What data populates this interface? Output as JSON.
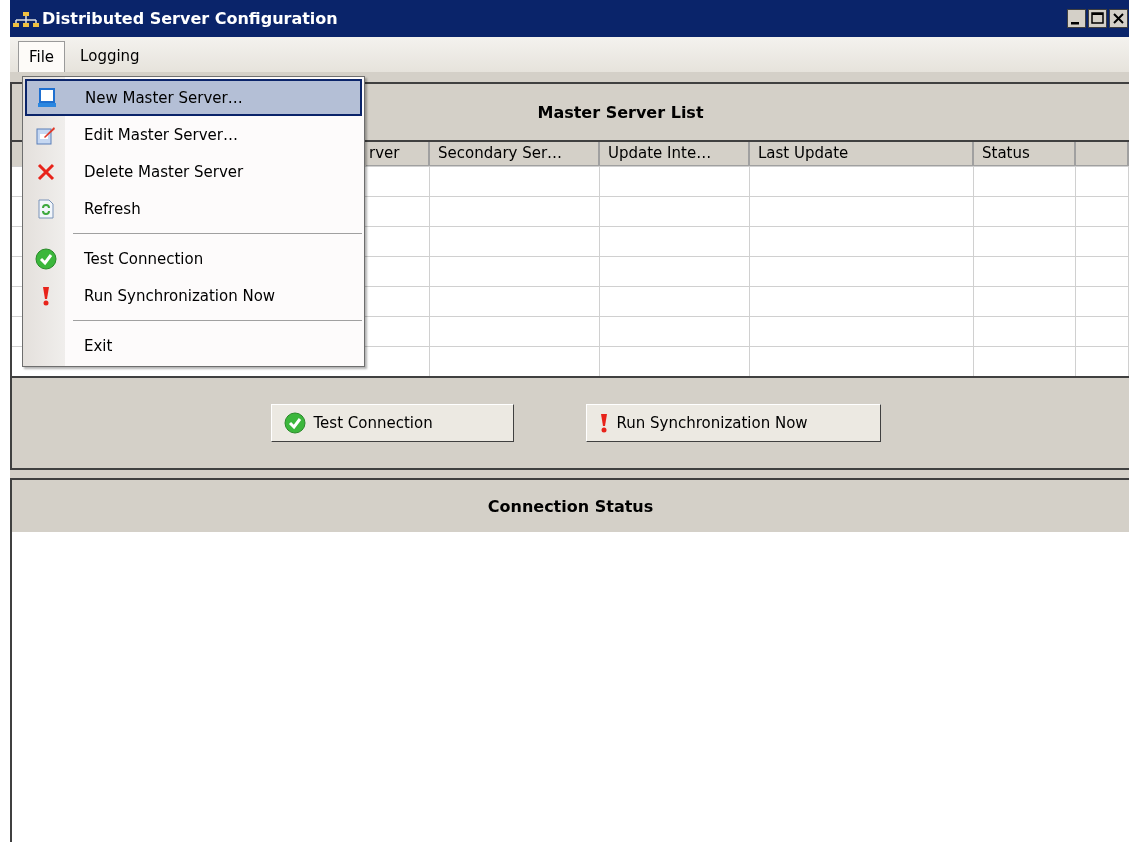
{
  "window": {
    "title": "Distributed Server Configuration"
  },
  "menu_bar": [
    {
      "label": "File",
      "selected": true
    },
    {
      "label": "Logging",
      "selected": false
    }
  ],
  "file_menu": [
    {
      "kind": "item",
      "label": "New Master Server…",
      "selected": true
    },
    {
      "kind": "item",
      "label": "Edit Master Server…",
      "selected": false
    },
    {
      "kind": "item",
      "label": "Delete Master Server",
      "selected": false
    },
    {
      "kind": "item",
      "label": "Refresh",
      "selected": false
    },
    {
      "kind": "separator"
    },
    {
      "kind": "item",
      "label": "Test Connection",
      "selected": false
    },
    {
      "kind": "item",
      "label": "Run Synchronization Now",
      "selected": false
    },
    {
      "kind": "separator"
    },
    {
      "kind": "item",
      "label": "Exit",
      "selected": false
    }
  ],
  "master_panel": {
    "title": "Master Server List",
    "columns": [
      "rver",
      "Secondary Ser…",
      "Update Inte…",
      "Last Update",
      "Status"
    ]
  },
  "buttons": [
    {
      "label": "Test Connection"
    },
    {
      "label": "Run Synchronization Now"
    }
  ],
  "status_panel": {
    "title": "Connection Status"
  }
}
